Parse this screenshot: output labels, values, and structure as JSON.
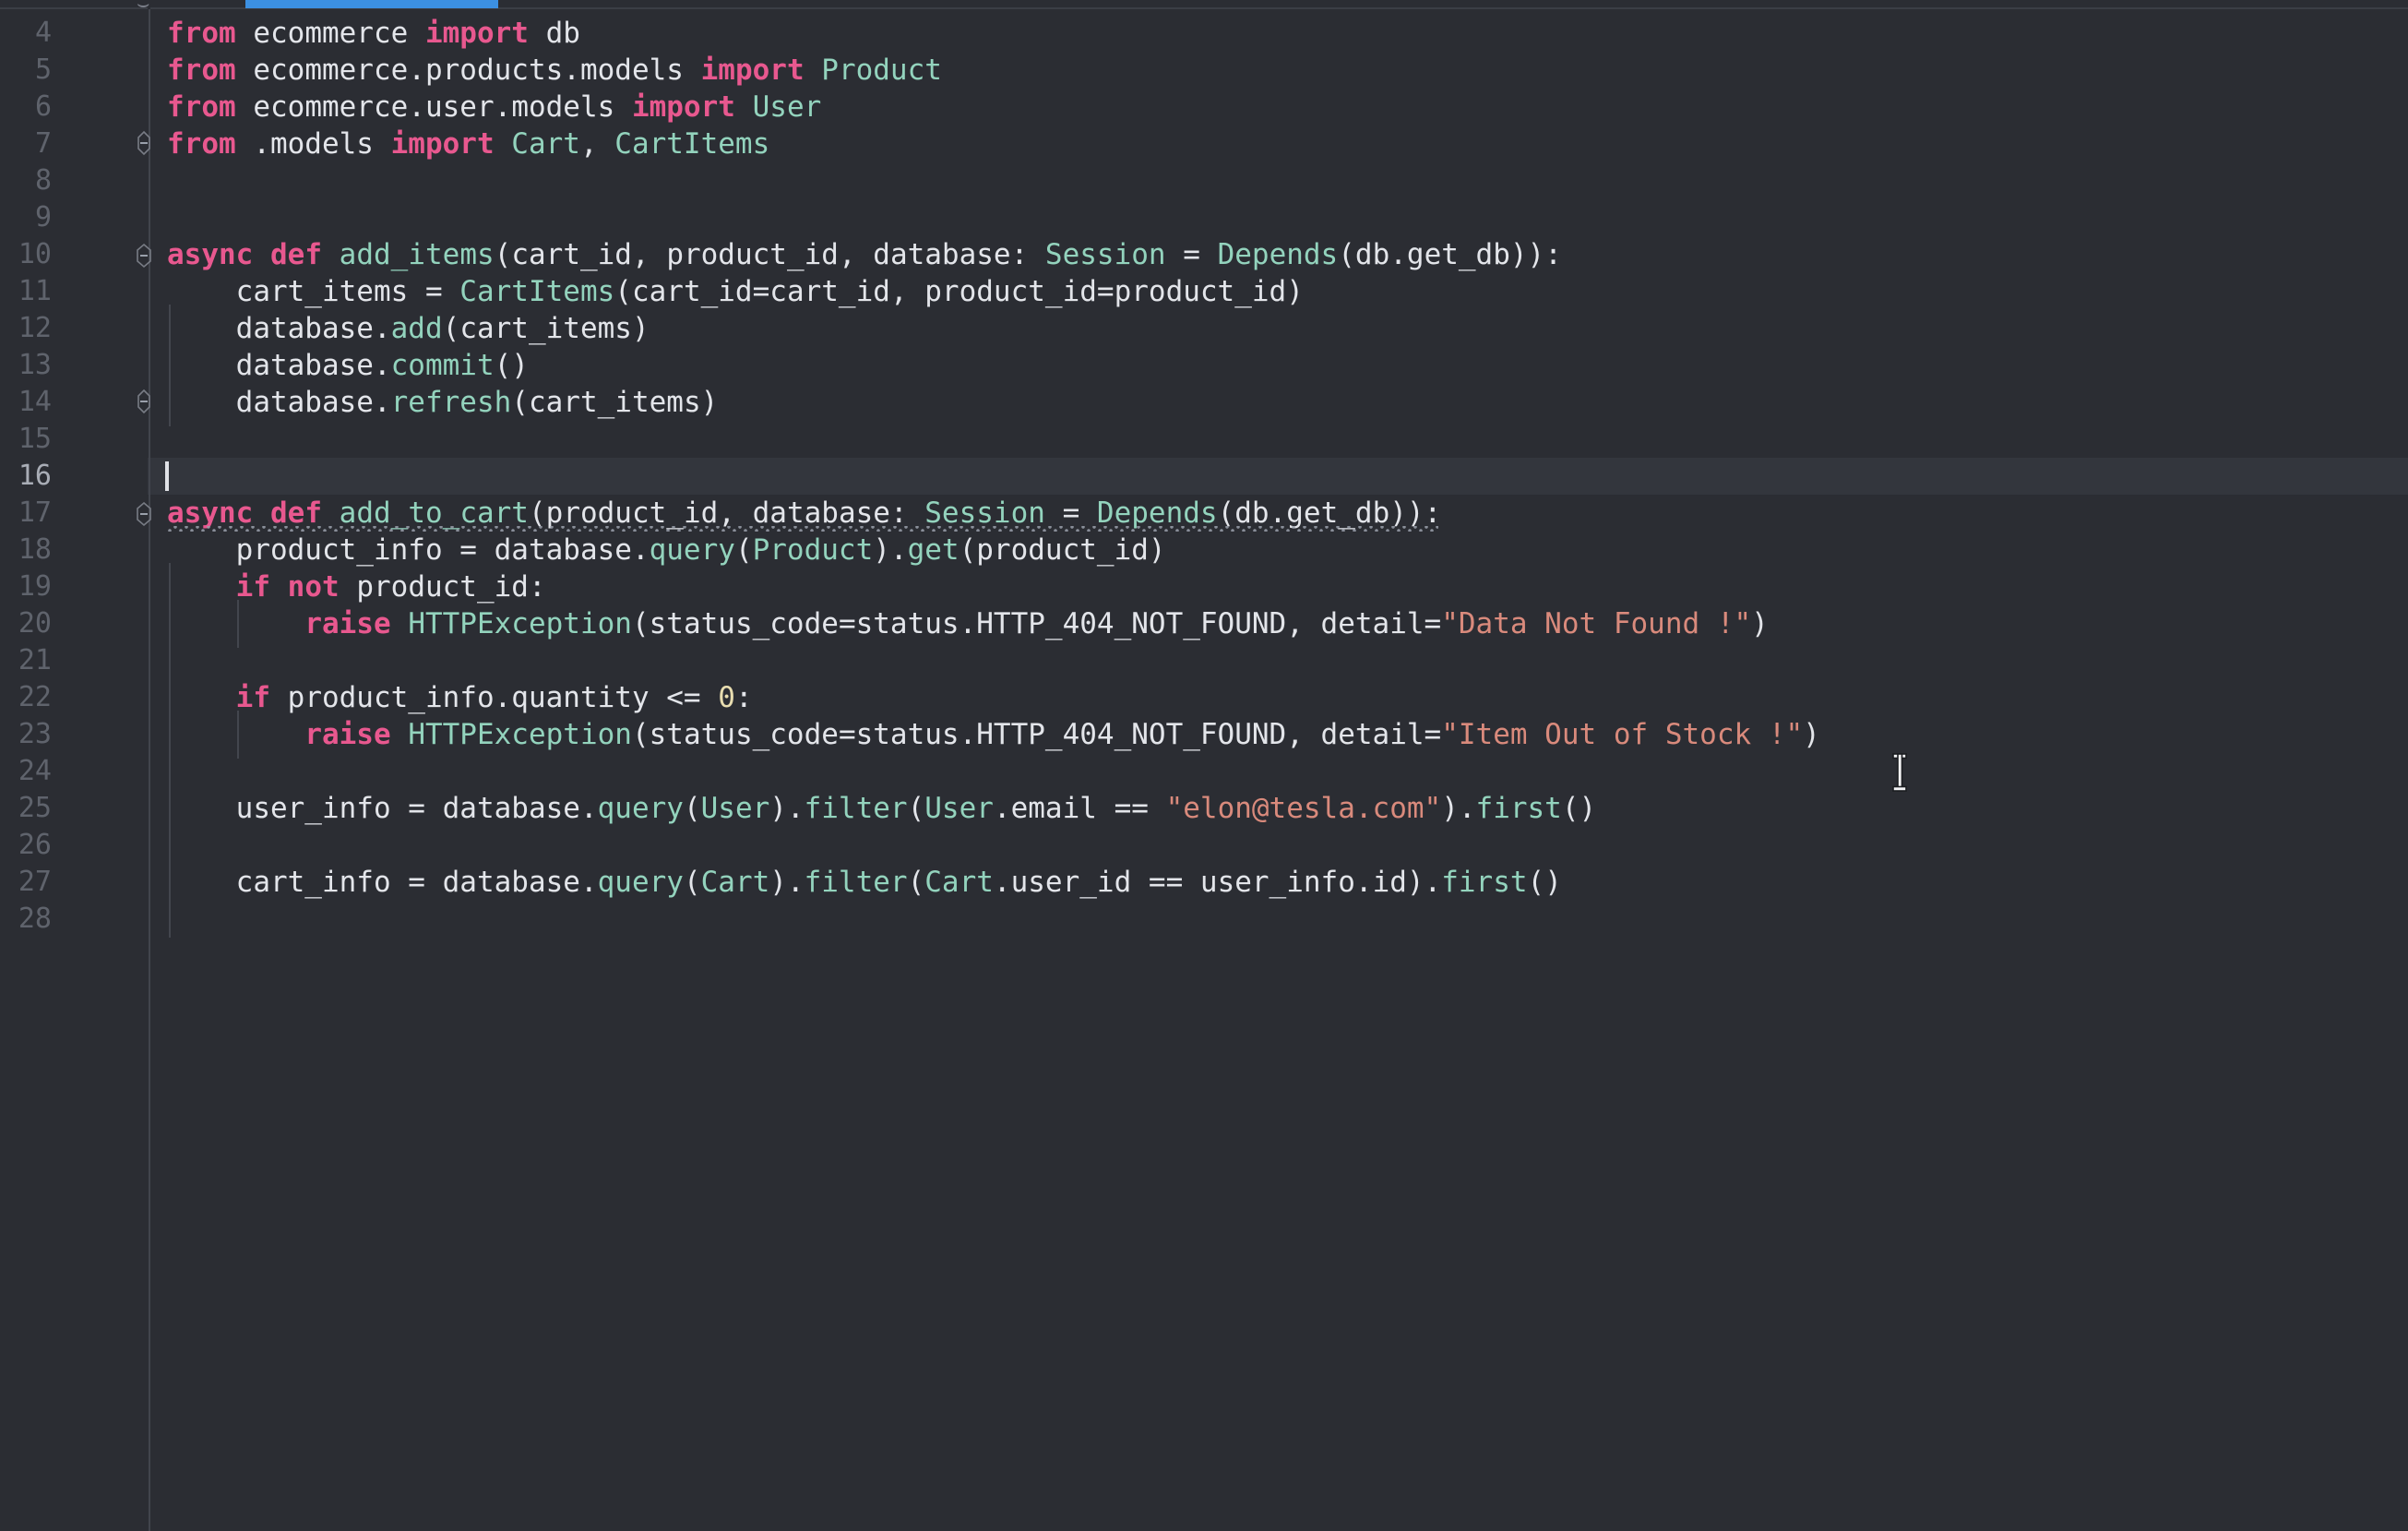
{
  "editor": {
    "language": "python",
    "theme": "dark",
    "accent_color": "#3c90e2",
    "background_color": "#2b2d33",
    "current_line_color": "#33363d",
    "gutter_text_color": "#5f636c",
    "current_line_number": "16",
    "first_visible_line": "4",
    "last_visible_line": "28",
    "caret_line": "16",
    "caret_column": "1"
  },
  "palette": {
    "keyword": "#e8588f",
    "function": "#93d3bd",
    "class": "#93d3bd",
    "string": "#d98a7c",
    "number": "#e8ddb0",
    "identifier": "#e3e5ea",
    "operator": "#e3e5ea",
    "error_squiggle": "#9aa0ab"
  },
  "gutter": {
    "line_numbers": [
      "4",
      "5",
      "6",
      "7",
      "8",
      "9",
      "10",
      "11",
      "12",
      "13",
      "14",
      "15",
      "16",
      "17",
      "18",
      "19",
      "20",
      "21",
      "22",
      "23",
      "24",
      "25",
      "26",
      "27",
      "28"
    ],
    "fold_markers": [
      {
        "line": "7",
        "type": "fold-end-icon"
      },
      {
        "line": "10",
        "type": "fold-start-icon"
      },
      {
        "line": "14",
        "type": "fold-end-icon"
      },
      {
        "line": "17",
        "type": "fold-start-icon"
      }
    ]
  },
  "code": {
    "lines": [
      {
        "n": "4",
        "text": "from ecommerce import db"
      },
      {
        "n": "5",
        "text": "from ecommerce.products.models import Product"
      },
      {
        "n": "6",
        "text": "from ecommerce.user.models import User"
      },
      {
        "n": "7",
        "text": "from .models import Cart, CartItems"
      },
      {
        "n": "8",
        "text": ""
      },
      {
        "n": "9",
        "text": ""
      },
      {
        "n": "10",
        "text": "async def add_items(cart_id, product_id, database: Session = Depends(db.get_db)):"
      },
      {
        "n": "11",
        "text": "    cart_items = CartItems(cart_id=cart_id, product_id=product_id)"
      },
      {
        "n": "12",
        "text": "    database.add(cart_items)"
      },
      {
        "n": "13",
        "text": "    database.commit()"
      },
      {
        "n": "14",
        "text": "    database.refresh(cart_items)"
      },
      {
        "n": "15",
        "text": ""
      },
      {
        "n": "16",
        "text": ""
      },
      {
        "n": "17",
        "text": "async def add_to_cart(product_id, database: Session = Depends(db.get_db)):"
      },
      {
        "n": "18",
        "text": "    product_info = database.query(Product).get(product_id)"
      },
      {
        "n": "19",
        "text": "    if not product_id:"
      },
      {
        "n": "20",
        "text": "        raise HTTPException(status_code=status.HTTP_404_NOT_FOUND, detail=\"Data Not Found !\")"
      },
      {
        "n": "21",
        "text": ""
      },
      {
        "n": "22",
        "text": "    if product_info.quantity <= 0:"
      },
      {
        "n": "23",
        "text": "        raise HTTPException(status_code=status.HTTP_404_NOT_FOUND, detail=\"Item Out of Stock !\")"
      },
      {
        "n": "24",
        "text": ""
      },
      {
        "n": "25",
        "text": "    user_info = database.query(User).filter(User.email == \"elon@tesla.com\").first()"
      },
      {
        "n": "26",
        "text": ""
      },
      {
        "n": "27",
        "text": "    cart_info = database.query(Cart).filter(Cart.user_id == user_info.id).first()"
      },
      {
        "n": "28",
        "text": ""
      }
    ],
    "strings": [
      "Data Not Found !",
      "Item Out of Stock !",
      "elon@tesla.com"
    ],
    "identifiers": [
      "db",
      "Product",
      "User",
      "Cart",
      "CartItems",
      "Session",
      "Depends",
      "HTTPException",
      "status"
    ],
    "keywords": [
      "from",
      "import",
      "async",
      "def",
      "if",
      "not",
      "raise"
    ]
  },
  "diagnostics": {
    "line": "17",
    "kind": "warning-squiggle"
  },
  "pointer": {
    "kind": "text-ibeam-cursor",
    "x": "2046",
    "y": "815"
  }
}
